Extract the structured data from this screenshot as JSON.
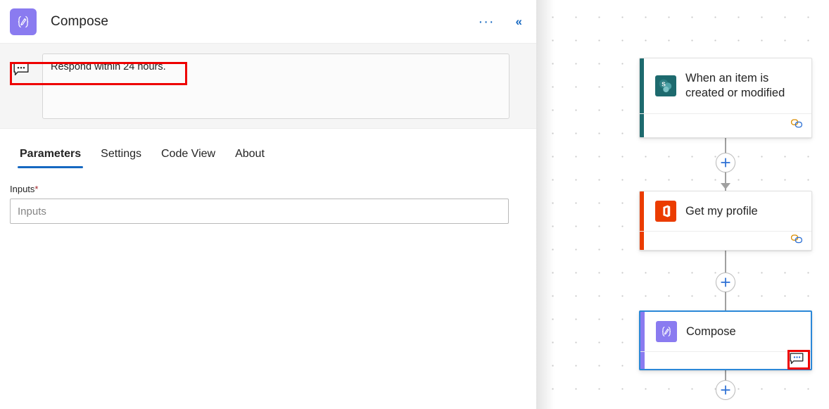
{
  "panel": {
    "icon_name": "compose-icon",
    "title": "Compose",
    "actions": {
      "more_label": "···",
      "more_name": "more-options-icon",
      "collapse_label": "«",
      "collapse_name": "collapse-panel-icon"
    },
    "comment": {
      "icon_name": "comment-icon",
      "text": "Respond within 24 hours."
    },
    "tabs": [
      {
        "label": "Parameters",
        "active": true
      },
      {
        "label": "Settings",
        "active": false
      },
      {
        "label": "Code View",
        "active": false
      },
      {
        "label": "About",
        "active": false
      }
    ],
    "form": {
      "inputs_label": "Inputs",
      "required_marker": "*",
      "inputs_value": "",
      "inputs_placeholder": "Inputs"
    }
  },
  "canvas": {
    "nodes": [
      {
        "id": "trigger",
        "title": "When an item is created or modified",
        "icon_name": "sharepoint-icon",
        "accent_color": "#1d6a6e",
        "selected": false,
        "footer_icon": "connection-link-icon"
      },
      {
        "id": "profile",
        "title": "Get my profile",
        "icon_name": "office365-icon",
        "accent_color": "#eb3c00",
        "selected": false,
        "footer_icon": "connection-link-icon"
      },
      {
        "id": "compose",
        "title": "Compose",
        "icon_name": "compose-icon",
        "accent_color": "#8a7bf0",
        "selected": true,
        "footer_icon": "comment-icon"
      }
    ],
    "add_buttons": [
      {
        "name": "add-step-button-1",
        "label": "+"
      },
      {
        "name": "add-step-button-2",
        "label": "+"
      },
      {
        "name": "add-step-button-3",
        "label": "+"
      }
    ]
  },
  "colors": {
    "accent_blue": "#1668c1",
    "selection_blue": "#2b88d8",
    "annotation_red": "#ee0000",
    "required_red": "#a4262c",
    "sharepoint_teal": "#1d6a6e",
    "office_orange": "#eb3c00",
    "compose_purple": "#8a7bf0"
  }
}
